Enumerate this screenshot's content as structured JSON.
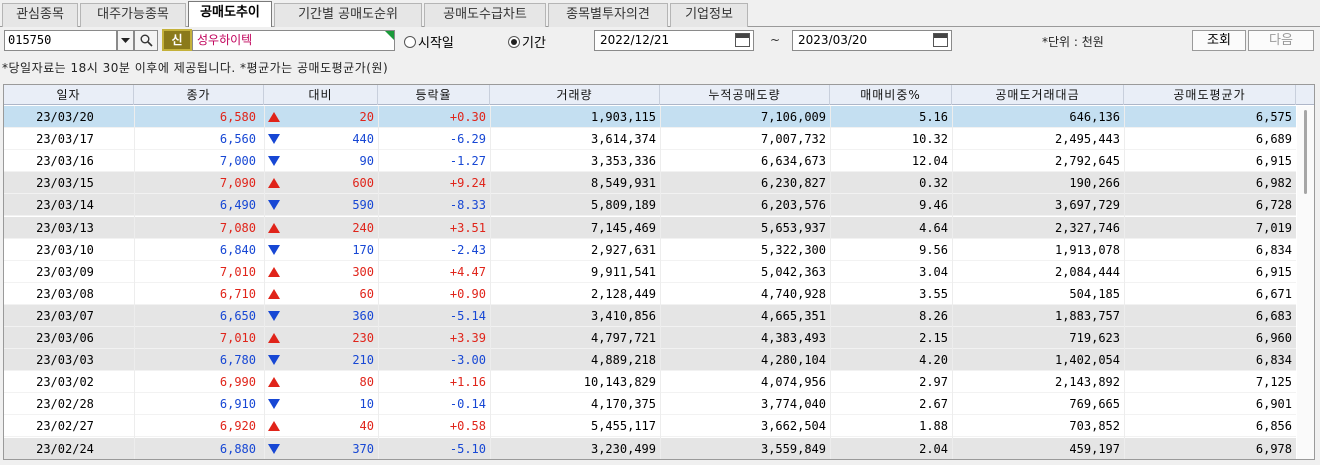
{
  "tabs": [
    "관심종목",
    "대주가능종목",
    "공매도추이",
    "기간별 공매도순위",
    "공매도수급차트",
    "종목별투자의견",
    "기업정보"
  ],
  "active_tab": 2,
  "toolbar": {
    "code": "015750",
    "new_badge": "신",
    "stock_name": "성우하이텍",
    "radio_start": "시작일",
    "radio_period": "기간",
    "selected_radio": "period",
    "date_from": "2022/12/21",
    "tilde": "~",
    "date_to": "2023/03/20",
    "unit": "*단위 : 천원",
    "query_button": "조회",
    "next_button": "다음"
  },
  "notice": "*당일자료는 18시 30분 이후에 제공됩니다. *평균가는 공매도평균가(원)",
  "table": {
    "headers": [
      "일자",
      "종가",
      "대비",
      "등락율",
      "거래량",
      "누적공매도량",
      "매매비중%",
      "공매도거래대금",
      "공매도평균가"
    ],
    "rows": [
      {
        "date": "23/03/20",
        "close": "6,580",
        "dir": "up",
        "change": "20",
        "rate": "+0.30",
        "volume": "1,903,115",
        "cum": "7,106,009",
        "ratio": "5.16",
        "amount": "646,136",
        "avg": "6,575"
      },
      {
        "date": "23/03/17",
        "close": "6,560",
        "dir": "down",
        "change": "440",
        "rate": "-6.29",
        "volume": "3,614,374",
        "cum": "7,007,732",
        "ratio": "10.32",
        "amount": "2,495,443",
        "avg": "6,689"
      },
      {
        "date": "23/03/16",
        "close": "7,000",
        "dir": "down",
        "change": "90",
        "rate": "-1.27",
        "volume": "3,353,336",
        "cum": "6,634,673",
        "ratio": "12.04",
        "amount": "2,792,645",
        "avg": "6,915"
      },
      {
        "date": "23/03/15",
        "close": "7,090",
        "dir": "up",
        "change": "600",
        "rate": "+9.24",
        "volume": "8,549,931",
        "cum": "6,230,827",
        "ratio": "0.32",
        "amount": "190,266",
        "avg": "6,982"
      },
      {
        "date": "23/03/14",
        "close": "6,490",
        "dir": "down",
        "change": "590",
        "rate": "-8.33",
        "volume": "5,809,189",
        "cum": "6,203,576",
        "ratio": "9.46",
        "amount": "3,697,729",
        "avg": "6,728"
      },
      {
        "date": "23/03/13",
        "close": "7,080",
        "dir": "up",
        "change": "240",
        "rate": "+3.51",
        "volume": "7,145,469",
        "cum": "5,653,937",
        "ratio": "4.64",
        "amount": "2,327,746",
        "avg": "7,019"
      },
      {
        "date": "23/03/10",
        "close": "6,840",
        "dir": "down",
        "change": "170",
        "rate": "-2.43",
        "volume": "2,927,631",
        "cum": "5,322,300",
        "ratio": "9.56",
        "amount": "1,913,078",
        "avg": "6,834"
      },
      {
        "date": "23/03/09",
        "close": "7,010",
        "dir": "up",
        "change": "300",
        "rate": "+4.47",
        "volume": "9,911,541",
        "cum": "5,042,363",
        "ratio": "3.04",
        "amount": "2,084,444",
        "avg": "6,915"
      },
      {
        "date": "23/03/08",
        "close": "6,710",
        "dir": "up",
        "change": "60",
        "rate": "+0.90",
        "volume": "2,128,449",
        "cum": "4,740,928",
        "ratio": "3.55",
        "amount": "504,185",
        "avg": "6,671"
      },
      {
        "date": "23/03/07",
        "close": "6,650",
        "dir": "down",
        "change": "360",
        "rate": "-5.14",
        "volume": "3,410,856",
        "cum": "4,665,351",
        "ratio": "8.26",
        "amount": "1,883,757",
        "avg": "6,683"
      },
      {
        "date": "23/03/06",
        "close": "7,010",
        "dir": "up",
        "change": "230",
        "rate": "+3.39",
        "volume": "4,797,721",
        "cum": "4,383,493",
        "ratio": "2.15",
        "amount": "719,623",
        "avg": "6,960"
      },
      {
        "date": "23/03/03",
        "close": "6,780",
        "dir": "down",
        "change": "210",
        "rate": "-3.00",
        "volume": "4,889,218",
        "cum": "4,280,104",
        "ratio": "4.20",
        "amount": "1,402,054",
        "avg": "6,834"
      },
      {
        "date": "23/03/02",
        "close": "6,990",
        "dir": "up",
        "change": "80",
        "rate": "+1.16",
        "volume": "10,143,829",
        "cum": "4,074,956",
        "ratio": "2.97",
        "amount": "2,143,892",
        "avg": "7,125"
      },
      {
        "date": "23/02/28",
        "close": "6,910",
        "dir": "down",
        "change": "10",
        "rate": "-0.14",
        "volume": "4,170,375",
        "cum": "3,774,040",
        "ratio": "2.67",
        "amount": "769,665",
        "avg": "6,901"
      },
      {
        "date": "23/02/27",
        "close": "6,920",
        "dir": "up",
        "change": "40",
        "rate": "+0.58",
        "volume": "5,455,117",
        "cum": "3,662,504",
        "ratio": "1.88",
        "amount": "703,852",
        "avg": "6,856"
      },
      {
        "date": "23/02/24",
        "close": "6,880",
        "dir": "down",
        "change": "370",
        "rate": "-5.10",
        "volume": "3,230,499",
        "cum": "3,559,849",
        "ratio": "2.04",
        "amount": "459,197",
        "avg": "6,978"
      }
    ],
    "row_shading": [
      "sel",
      "white",
      "white",
      "gray",
      "gray",
      "gray",
      "white",
      "white",
      "white",
      "gray",
      "gray",
      "gray",
      "white",
      "white",
      "white",
      "gray"
    ],
    "colors": {
      "up": "#e0241a",
      "down": "#1747d4",
      "selected_row": "#c4dff1",
      "shaded_row": "#e5e5e5"
    }
  }
}
